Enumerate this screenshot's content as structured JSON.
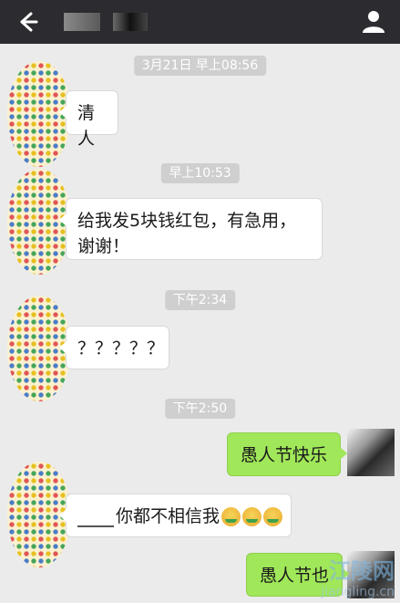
{
  "header": {
    "back_icon": "arrow-left-icon",
    "contact_icon": "person-icon"
  },
  "messages": [
    {
      "time": "3月21日 早上08:56",
      "text": "清人"
    },
    {
      "time": "早上10:53",
      "text_line1": "给我发5块钱红包，有急用，",
      "text_line2": "谢谢！"
    },
    {
      "time": "下午2:34",
      "text": "？？？？？"
    },
    {
      "time": "下午2:50",
      "out_text": "愚人节快乐",
      "in_text": "你都不相信我",
      "emoji_icons": [
        "crying-laughing-emoji",
        "crying-laughing-emoji",
        "crying-laughing-emoji"
      ],
      "out_text_2": "愚人节也"
    }
  ],
  "watermark": {
    "title": "江陵网",
    "subtitle": "jiangling.cn"
  },
  "colors": {
    "topbar": "#2b2b30",
    "background": "#ebebeb",
    "bubble_out": "#a0e759",
    "bubble_in": "#ffffff",
    "timestamp_bg": "#cfcfcf"
  }
}
